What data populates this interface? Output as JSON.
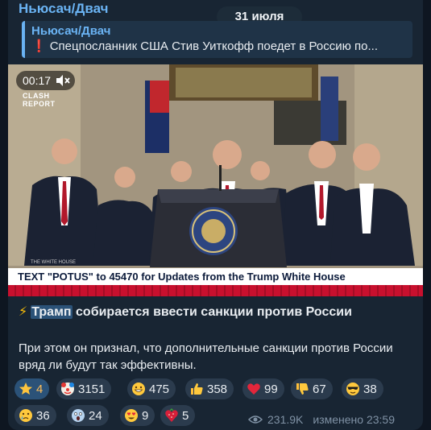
{
  "post": {
    "channel": "Ньюсач/Двач",
    "date_pill": "31 июля",
    "reply": {
      "channel": "Ньюсач/Двач",
      "text": "Спецпосланник США Стив Уиткофф поедет в Россию по..."
    },
    "video": {
      "time": "00:17",
      "logo_line1": "CLASH",
      "logo_line2": "REPORT",
      "lower_third": "TEXT \"POTUS\" to 45470 for Updates from the Trump White House",
      "podium_tag": "THE WHITE HOUSE"
    },
    "headline": {
      "highlight": "Трамп",
      "rest": " собирается ввести санкции против России"
    },
    "body": "При этом он признал, что дополнительные санкции против России вряд ли будут так эффективны.",
    "reactions": [
      {
        "emoji": "star-icon",
        "count": "4"
      },
      {
        "emoji": "clown-icon",
        "count": "3151"
      },
      {
        "emoji": "grin-icon",
        "count": "475"
      },
      {
        "emoji": "thumbs-up-icon",
        "count": "358"
      },
      {
        "emoji": "heart-icon",
        "count": "99"
      },
      {
        "emoji": "thumbs-down-icon",
        "count": "67"
      },
      {
        "emoji": "sunglasses-icon",
        "count": "38"
      },
      {
        "emoji": "crying-icon",
        "count": "36"
      },
      {
        "emoji": "screaming-icon",
        "count": "24"
      },
      {
        "emoji": "heart-eyes-icon",
        "count": "9"
      },
      {
        "emoji": "heart-strawberry-icon",
        "count": "5"
      }
    ],
    "views": "231.9K",
    "edited": "изменено 23:59"
  },
  "colors": {
    "accent": "#6ab3f3",
    "background": "#0e1621",
    "bubble": "#182533",
    "lower_third_red": "#c8102e"
  }
}
